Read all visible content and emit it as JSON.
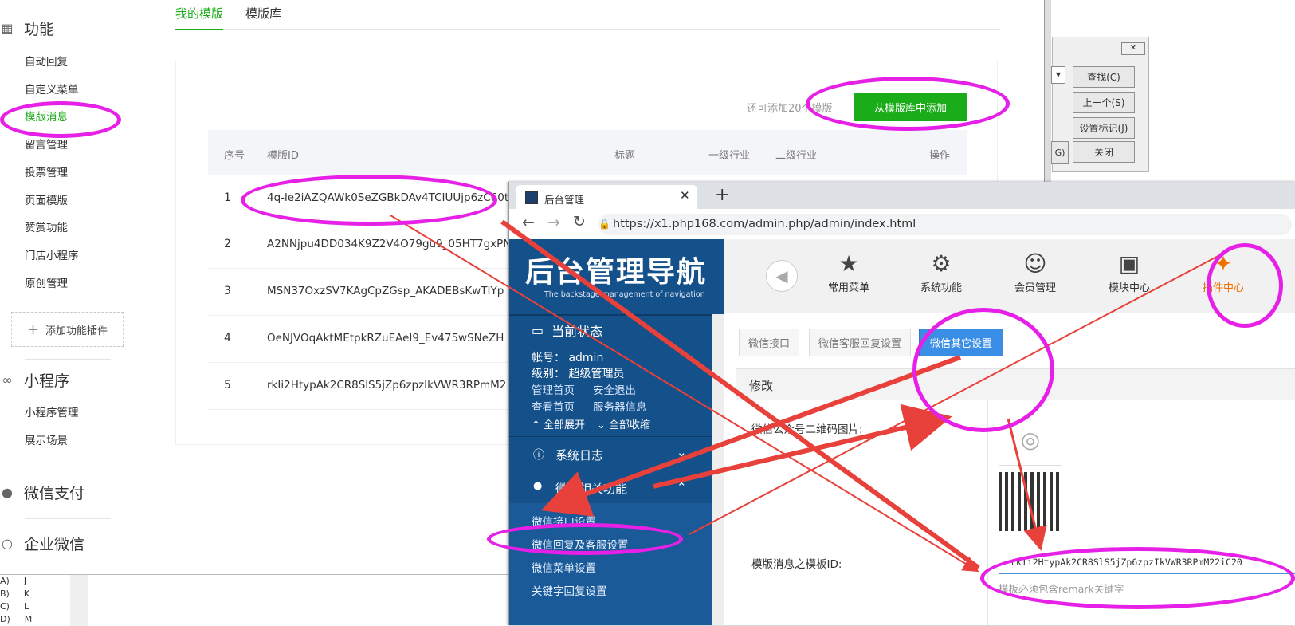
{
  "sidebar": {
    "sections": [
      {
        "title": "功能",
        "items": [
          "自动回复",
          "自定义菜单",
          "模版消息",
          "留言管理",
          "投票管理",
          "页面模版",
          "赞赏功能",
          "门店小程序",
          "原创管理"
        ]
      },
      {
        "title": "小程序",
        "items": [
          "小程序管理",
          "展示场景"
        ]
      },
      {
        "title": "微信支付",
        "items": []
      },
      {
        "title": "企业微信",
        "items": []
      }
    ],
    "active_item": "模版消息",
    "add_plugin": "添加功能插件",
    "footer_options": [
      "J",
      "K",
      "L",
      "M"
    ],
    "footer_letters": [
      "A)",
      "B)",
      "C)",
      "D)"
    ]
  },
  "template_page": {
    "tabs": [
      "我的模版",
      "模版库"
    ],
    "hint": "还可添加20个模版",
    "add_button": "从模版库中添加",
    "columns": [
      "序号",
      "模版ID",
      "标题",
      "一级行业",
      "二级行业",
      "操作"
    ],
    "rows": [
      {
        "num": "1",
        "id": "4q-le2iAZQAWk0SeZGBkDAv4TCIUUjp6zC60t"
      },
      {
        "num": "2",
        "id": "A2NNjpu4DD034K9Z2V4O79gu9_05HT7gxPN"
      },
      {
        "num": "3",
        "id": "MSN37OxzSV7KAgCpZGsp_AKADEBsKwTIYp"
      },
      {
        "num": "4",
        "id": "OeNJVOqAktMEtpkRZuEAeI9_Ev475wSNeZH"
      },
      {
        "num": "5",
        "id": "rkIi2HtypAk2CR8SlS5jZp6zpzIkVWR3RPmM2"
      }
    ]
  },
  "find_dialog": {
    "buttons": [
      "查找(C)",
      "上一个(S)",
      "设置标记(J)",
      "关闭"
    ],
    "partial_label": "G)"
  },
  "browser": {
    "tab_title": "后台管理",
    "url": "https://x1.php168.com/admin.php/admin/index.html",
    "logo_cn": "后台管理导航",
    "logo_en": "The backstage management of navigation",
    "top_menu": [
      "常用菜单",
      "系统功能",
      "会员管理",
      "模块中心",
      "插件中心"
    ],
    "status_title": "当前状态",
    "account_label": "帐号：",
    "account_value": "admin",
    "level_label": "级别：",
    "level_value": "超级管理员",
    "links": [
      "管理首页",
      "安全退出",
      "查看首页",
      "服务器信息"
    ],
    "expand_all": "全部展开",
    "collapse_all": "全部收缩",
    "menu_groups": [
      "系统日志",
      "微信相关功能"
    ],
    "wechat_items": [
      "微信接口设置",
      "微信回复及客服设置",
      "微信菜单设置",
      "关键字回复设置"
    ],
    "sub_tabs": [
      "微信接口",
      "微信客服回复设置",
      "微信其它设置"
    ],
    "panel_title": "修改",
    "qr_label": "微信公众号二维码图片:",
    "template_label": "模版消息之模板ID:",
    "template_value": "rkIi2HtypAk2CR8SlS5jZp6zpzIkVWR3RPmM22iC20",
    "template_hint": "模板必须包含remark关键字"
  },
  "colors": {
    "accent_green": "#1aad19",
    "annotation": "#e620e6",
    "arrow": "#e8403a",
    "admin_blue": "#14508a"
  }
}
